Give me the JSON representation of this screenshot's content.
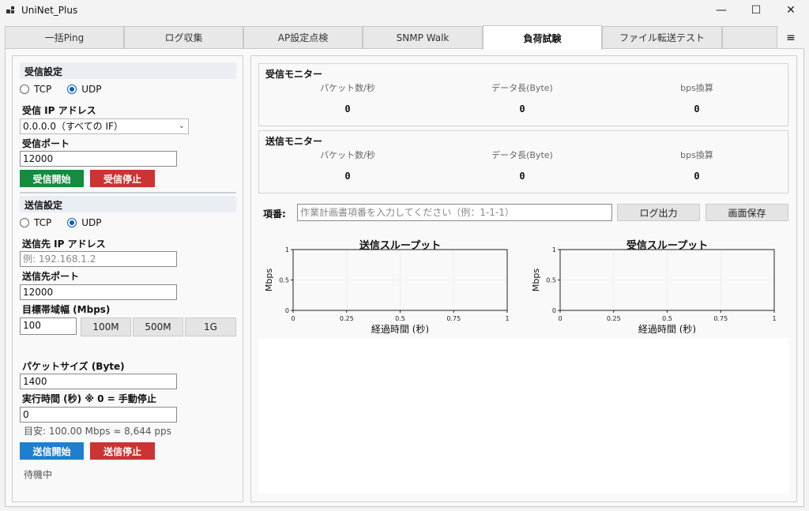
{
  "window": {
    "title": "UniNet_Plus",
    "minimize": "—",
    "maximize": "☐",
    "close": "✕"
  },
  "tabs": [
    {
      "label": "一括Ping"
    },
    {
      "label": "ログ収集"
    },
    {
      "label": "AP設定点検"
    },
    {
      "label": "SNMP Walk"
    },
    {
      "label": "負荷試験",
      "active": true
    },
    {
      "label": "ファイル転送テスト"
    }
  ],
  "menu_icon": "≡",
  "receive": {
    "section_title": "受信設定",
    "protocol": {
      "tcp": "TCP",
      "udp": "UDP",
      "selected": "UDP"
    },
    "ip_label": "受信 IP アドレス",
    "ip_value": "0.0.0.0（すべての IF）",
    "port_label": "受信ポート",
    "port_value": "12000",
    "start_button": "受信開始",
    "stop_button": "受信停止"
  },
  "send": {
    "section_title": "送信設定",
    "protocol": {
      "tcp": "TCP",
      "udp": "UDP",
      "selected": "UDP"
    },
    "dest_ip_label": "送信先 IP アドレス",
    "dest_ip_placeholder": "例: 192.168.1.2",
    "dest_port_label": "送信先ポート",
    "dest_port_value": "12000",
    "bandwidth_label": "目標帯域幅 (Mbps)",
    "bandwidth_value": "100",
    "presets": [
      "100M",
      "500M",
      "1G"
    ],
    "packet_size_label": "パケットサイズ (Byte)",
    "packet_size_value": "1400",
    "duration_label": "実行時間 (秒) ※ 0 = 手動停止",
    "duration_value": "0",
    "estimate": "目安: 100.00 Mbps  ≈ 8,644 pps",
    "start_button": "送信開始",
    "stop_button": "送信停止",
    "status": "待機中"
  },
  "rx_monitor": {
    "title": "受信モニター",
    "columns": [
      {
        "label": "パケット数/秒",
        "value": "0"
      },
      {
        "label": "データ長(Byte)",
        "value": "0"
      },
      {
        "label": "bps換算",
        "value": "0"
      }
    ]
  },
  "tx_monitor": {
    "title": "送信モニター",
    "columns": [
      {
        "label": "パケット数/秒",
        "value": "0"
      },
      {
        "label": "データ長(Byte)",
        "value": "0"
      },
      {
        "label": "bps換算",
        "value": "0"
      }
    ]
  },
  "item": {
    "label": "項番:",
    "placeholder": "作業計画書項番を入力してください（例：1-1-1）",
    "log_button": "ログ出力",
    "save_button": "画面保存"
  },
  "chart_data": [
    {
      "type": "line",
      "title": "送信スループット",
      "xlabel": "経過時間 (秒)",
      "ylabel": "Mbps",
      "xlim": [
        0,
        1
      ],
      "ylim": [
        0,
        1
      ],
      "xticks": [
        "0",
        "0.25",
        "0.5",
        "0.75",
        "1"
      ],
      "yticks": [
        "0",
        "0.5",
        "1"
      ],
      "series": []
    },
    {
      "type": "line",
      "title": "受信スループット",
      "xlabel": "経過時間 (秒)",
      "ylabel": "Mbps",
      "xlim": [
        0,
        1
      ],
      "ylim": [
        0,
        1
      ],
      "xticks": [
        "0",
        "0.25",
        "0.5",
        "0.75",
        "1"
      ],
      "yticks": [
        "0",
        "0.5",
        "1"
      ],
      "series": []
    }
  ]
}
